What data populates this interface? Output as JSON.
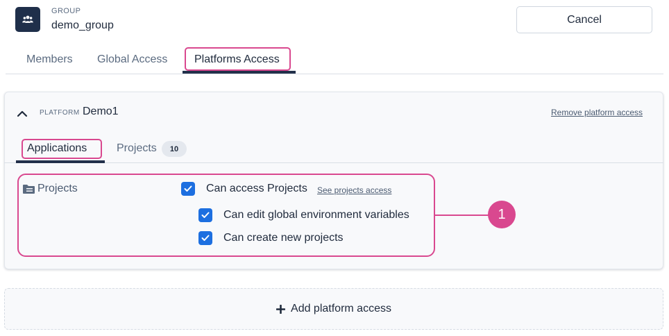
{
  "group": {
    "eyebrow": "GROUP",
    "name": "demo_group",
    "avatar_icon": "users-icon"
  },
  "cancel_label": "Cancel",
  "tabs": [
    {
      "label": "Members"
    },
    {
      "label": "Global Access"
    },
    {
      "label": "Platforms Access",
      "active": true
    }
  ],
  "platform": {
    "eyebrow": "PLATFORM",
    "name": "Demo1",
    "remove_label": "Remove platform access",
    "tabs": [
      {
        "label": "Applications",
        "active": true
      },
      {
        "label": "Projects",
        "count": "10"
      }
    ],
    "section_label": "Projects",
    "permissions": {
      "main": {
        "label": "Can access Projects",
        "link": "See projects access",
        "checked": true
      },
      "sub": [
        {
          "label": "Can edit global environment variables",
          "checked": true
        },
        {
          "label": "Can create new projects",
          "checked": true
        }
      ]
    }
  },
  "callout_number": "1",
  "add_platform_label": "Add platform access",
  "colors": {
    "accent": "#1d6fe0",
    "highlight": "#d9488f",
    "navy": "#1f2f4a"
  }
}
